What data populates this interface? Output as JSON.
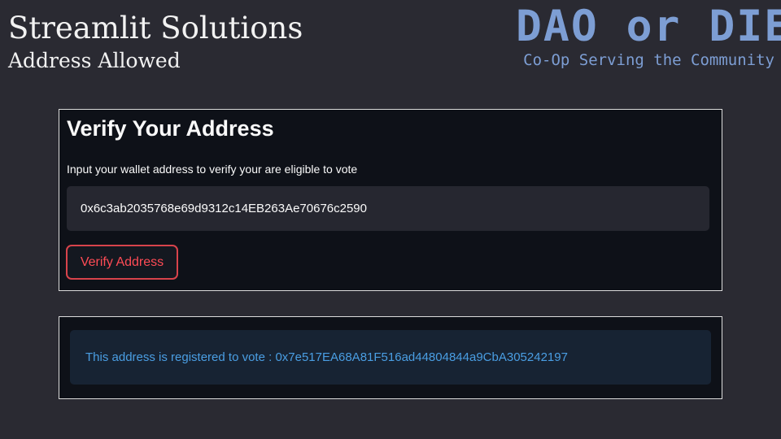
{
  "slide": {
    "title": "Streamlit Solutions",
    "subtitle": "Address Allowed"
  },
  "logo": {
    "title": "DAO or DIE",
    "tagline": "Co-Op Serving the Community",
    "color": "#7d9ed4"
  },
  "verify_panel": {
    "heading": "Verify Your Address",
    "label": "Input your wallet address to verify your are eligible to vote",
    "address_value": "0x6c3ab2035768e69d9312c14EB263Ae70676c2590",
    "button_label": "Verify Address",
    "button_color": "#ff4b55"
  },
  "result_panel": {
    "message": "This address is registered to vote : 0x7e517EA68A81F516ad44804844a9CbA305242197",
    "message_color": "#4a9ee3"
  }
}
